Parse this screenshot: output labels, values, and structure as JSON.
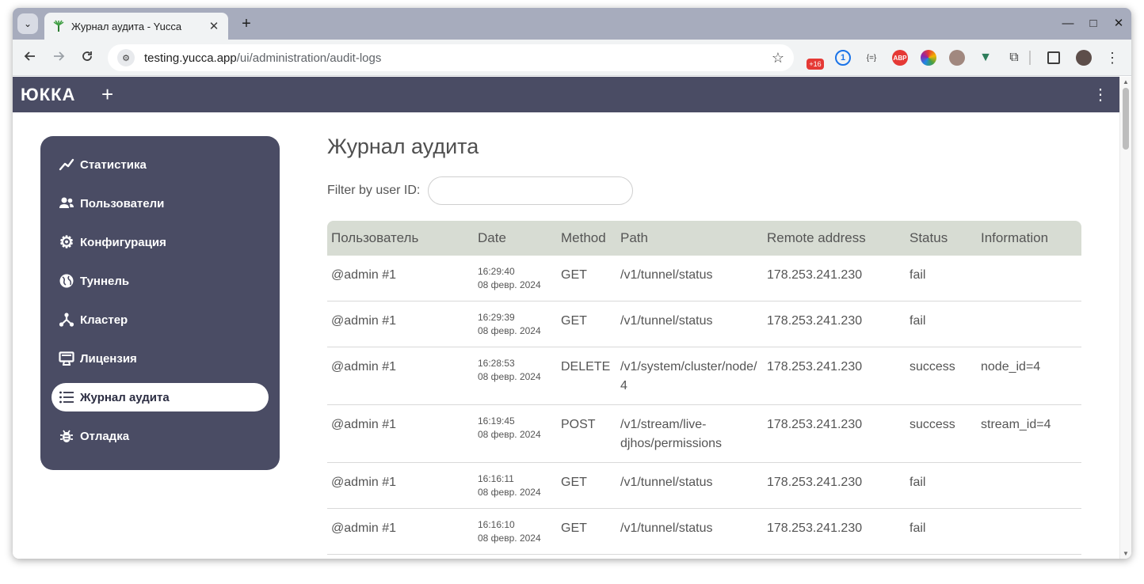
{
  "browser": {
    "tab_title": "Журнал аудита - Yucca",
    "url_host": "testing.yucca.app",
    "url_path": "/ui/administration/audit-logs",
    "extensions": [
      {
        "name": "badge-extension",
        "label": "+16",
        "color": "#e53935"
      },
      {
        "name": "1password",
        "label": "1",
        "color": "#1a73e8"
      },
      {
        "name": "json-viewer",
        "label": "{=}",
        "color": "#3c3c3c"
      },
      {
        "name": "adblock-plus",
        "label": "ABP",
        "color": "#e53935"
      },
      {
        "name": "color-picker",
        "label": "●",
        "color": "#f4b400"
      },
      {
        "name": "cookie-editor",
        "label": "●",
        "color": "#8d6e63"
      },
      {
        "name": "vue-devtools",
        "label": "▼",
        "color": "#2e7d5b"
      }
    ]
  },
  "app": {
    "logo": "ЮККА",
    "add_label": "+",
    "menu_label": "⋮"
  },
  "sidebar": {
    "items": [
      {
        "label": "Статистика",
        "icon": "chart-line-icon"
      },
      {
        "label": "Пользователи",
        "icon": "users-icon"
      },
      {
        "label": "Конфигурация",
        "icon": "gear-icon"
      },
      {
        "label": "Туннель",
        "icon": "globe-icon"
      },
      {
        "label": "Кластер",
        "icon": "cluster-icon"
      },
      {
        "label": "Лицензия",
        "icon": "license-icon"
      },
      {
        "label": "Журнал аудита",
        "icon": "list-icon",
        "active": true
      },
      {
        "label": "Отладка",
        "icon": "bug-icon"
      }
    ]
  },
  "main": {
    "title": "Журнал аудита",
    "filter_label": "Filter by user ID:",
    "filter_value": "",
    "columns": [
      "Пользователь",
      "Date",
      "Method",
      "Path",
      "Remote address",
      "Status",
      "Information"
    ],
    "rows": [
      {
        "user": "@admin #1",
        "time": "16:29:40",
        "date": "08 февр. 2024",
        "method": "GET",
        "path": "/v1/tunnel/status",
        "address": "178.253.241.230",
        "status": "fail",
        "info": ""
      },
      {
        "user": "@admin #1",
        "time": "16:29:39",
        "date": "08 февр. 2024",
        "method": "GET",
        "path": "/v1/tunnel/status",
        "address": "178.253.241.230",
        "status": "fail",
        "info": ""
      },
      {
        "user": "@admin #1",
        "time": "16:28:53",
        "date": "08 февр. 2024",
        "method": "DELETE",
        "path": "/v1/system/cluster/node/4",
        "address": "178.253.241.230",
        "status": "success",
        "info": "node_id=4"
      },
      {
        "user": "@admin #1",
        "time": "16:19:45",
        "date": "08 февр. 2024",
        "method": "POST",
        "path": "/v1/stream/live-djhos/permissions",
        "address": "178.253.241.230",
        "status": "success",
        "info": "stream_id=4"
      },
      {
        "user": "@admin #1",
        "time": "16:16:11",
        "date": "08 февр. 2024",
        "method": "GET",
        "path": "/v1/tunnel/status",
        "address": "178.253.241.230",
        "status": "fail",
        "info": ""
      },
      {
        "user": "@admin #1",
        "time": "16:16:10",
        "date": "08 февр. 2024",
        "method": "GET",
        "path": "/v1/tunnel/status",
        "address": "178.253.241.230",
        "status": "fail",
        "info": ""
      }
    ]
  },
  "colors": {
    "header_bg": "#4a4c64",
    "table_header_bg": "#d7dcd3",
    "text": "#555555"
  }
}
